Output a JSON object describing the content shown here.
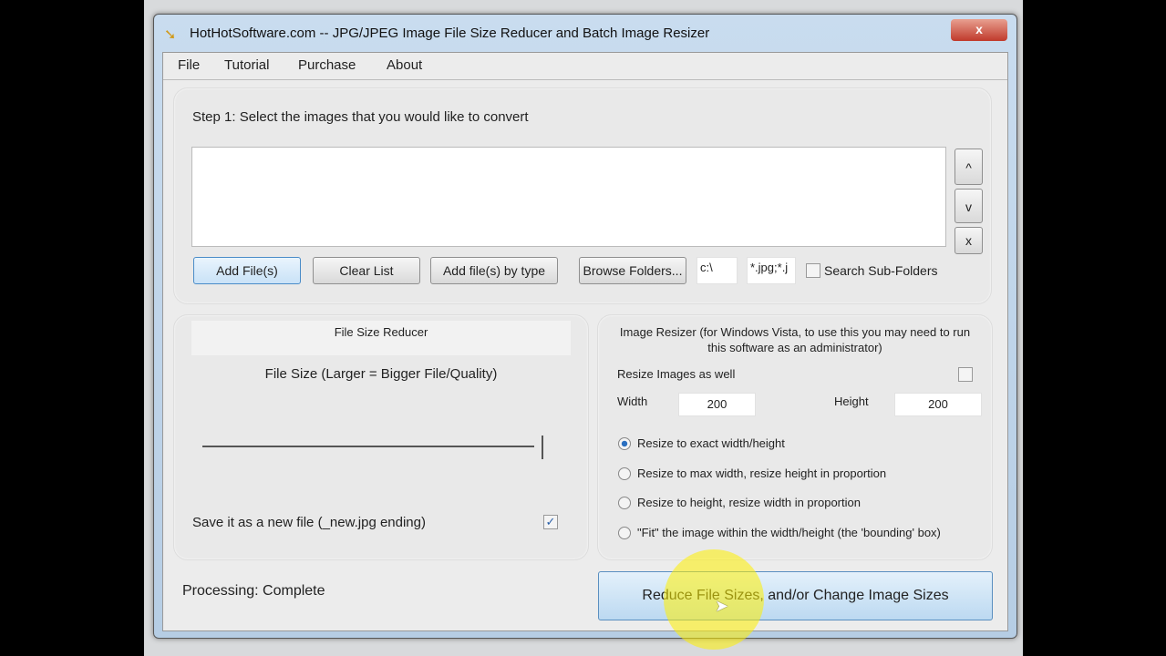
{
  "window": {
    "title": "HotHotSoftware.com -- JPG/JPEG Image File Size Reducer and Batch Image Resizer",
    "close": "x"
  },
  "menu": [
    "File",
    "Tutorial",
    "Purchase",
    "About"
  ],
  "step1": {
    "label": "Step 1: Select the images that you would like to convert",
    "up": "^",
    "down": "v",
    "remove": "x",
    "add_files": "Add File(s)",
    "clear_list": "Clear List",
    "add_by_type": "Add file(s) by type",
    "browse": "Browse Folders...",
    "folder": "c:\\",
    "pattern": "*.jpg;*.j",
    "search_sub": "Search Sub-Folders",
    "search_sub_checked": false
  },
  "reducer": {
    "header": "File Size Reducer",
    "caption": "File Size (Larger = Bigger File/Quality)",
    "slider_value": 1.0,
    "save_new": "Save it as a new file (_new.jpg ending)",
    "save_new_checked": true
  },
  "resizer": {
    "header": "Image Resizer (for Windows Vista, to use this you may need to run this software as an administrator)",
    "resize_as_well": "Resize Images as well",
    "resize_checked": false,
    "width_label": "Width",
    "width": "200",
    "height_label": "Height",
    "height": "200",
    "options": [
      "Resize to exact width/height",
      "Resize to max width, resize height in proportion",
      "Resize to height, resize width in proportion",
      "\"Fit\" the image within the width/height (the 'bounding' box)"
    ],
    "selected": 0
  },
  "status": "Processing: Complete",
  "go_button": "Reduce File Sizes, and/or Change Image Sizes"
}
